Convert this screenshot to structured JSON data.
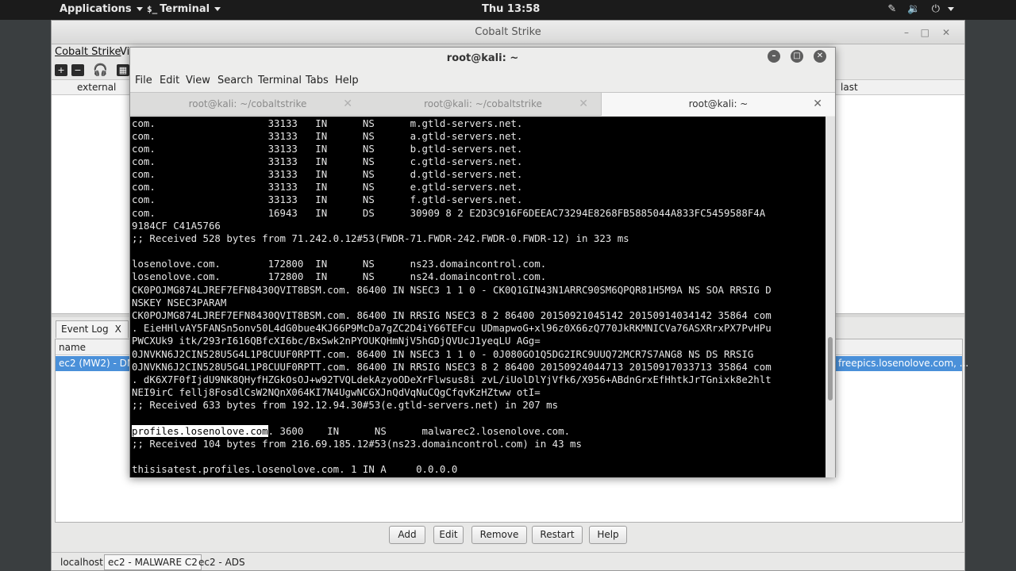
{
  "topbar": {
    "applications": "Applications",
    "terminal": "Terminal",
    "clock": "Thu 13:58"
  },
  "cobalt": {
    "title": "Cobalt Strike",
    "menu": [
      "Cobalt Strike",
      "View"
    ],
    "table_columns": {
      "external": "external",
      "last": "last"
    },
    "event_log_tab": "Event Log",
    "listener_columns": {
      "name": "name"
    },
    "listener_row": {
      "name": "ec2 (MW2) - DN",
      "hosts": "freepics.losenolove.com, ..."
    },
    "buttons": [
      "Add",
      "Edit",
      "Remove",
      "Restart",
      "Help"
    ],
    "bottom_tabs": [
      "localhost",
      "ec2 - MALWARE C2",
      "ec2 - ADS"
    ]
  },
  "terminal": {
    "title": "root@kali: ~",
    "menu": [
      "File",
      "Edit",
      "View",
      "Search",
      "Terminal",
      "Tabs",
      "Help"
    ],
    "tabs": [
      "root@kali: ~/cobaltstrike",
      "root@kali: ~/cobaltstrike",
      "root@kali: ~"
    ],
    "lines": [
      "com.                   33133   IN      NS      m.gtld-servers.net.",
      "com.                   33133   IN      NS      a.gtld-servers.net.",
      "com.                   33133   IN      NS      b.gtld-servers.net.",
      "com.                   33133   IN      NS      c.gtld-servers.net.",
      "com.                   33133   IN      NS      d.gtld-servers.net.",
      "com.                   33133   IN      NS      e.gtld-servers.net.",
      "com.                   33133   IN      NS      f.gtld-servers.net.",
      "com.                   16943   IN      DS      30909 8 2 E2D3C916F6DEEAC73294E8268FB5885044A833FC5459588F4A",
      "9184CF C41A5766",
      ";; Received 528 bytes from 71.242.0.12#53(FWDR-71.FWDR-242.FWDR-0.FWDR-12) in 323 ms",
      "",
      "losenolove.com.        172800  IN      NS      ns23.domaincontrol.com.",
      "losenolove.com.        172800  IN      NS      ns24.domaincontrol.com.",
      "CK0POJMG874LJREF7EFN8430QVIT8BSM.com. 86400 IN NSEC3 1 1 0 - CK0Q1GIN43N1ARRC90SM6QPQR81H5M9A NS SOA RRSIG D",
      "NSKEY NSEC3PARAM",
      "CK0POJMG874LJREF7EFN8430QVIT8BSM.com. 86400 IN RRSIG NSEC3 8 2 86400 20150921045142 20150914034142 35864 com",
      ". EieHHlvAY5FANSn5onv50L4dG0bue4KJ66P9McDa7gZC2D4iY66TEFcu UDmapwoG+xl96z0X66zQ770JkRKMNICVa76ASXRrxPX7PvHPu",
      "PWCXUk9 itk/293rI616QBfcXI6bc/BxSwk2nPYOUKQHmNjV5hGDjQVUcJ1yeqLU AGg=",
      "0JNVKN6J2CIN528U5G4L1P8CUUF0RPTT.com. 86400 IN NSEC3 1 1 0 - 0J080GO1Q5DG2IRC9UUQ72MCR7S7ANG8 NS DS RRSIG",
      "0JNVKN6J2CIN528U5G4L1P8CUUF0RPTT.com. 86400 IN RRSIG NSEC3 8 2 86400 20150924044713 20150917033713 35864 com",
      ". dK6X7F0fIjdU9NK8QHyfHZGkOsOJ+w92TVQLdekAzyoODeXrFlwsus8i zvL/iUolDlYjVfk6/X956+ABdnGrxEfHhtkJrTGnixk8e2hlt",
      "NEI9irC fellj8FosdlCsW2NQnX064KI7N4UgwNCGXJnQdVqNuCQgCfqvKzHZtww otI=",
      ";; Received 633 bytes from 192.12.94.30#53(e.gtld-servers.net) in 207 ms",
      "",
      ". 3600    IN      NS      malwarec2.losenolove.com.",
      ";; Received 104 bytes from 216.69.185.12#53(ns23.domaincontrol.com) in 43 ms",
      "",
      "thisisatest.profiles.losenolove.com. 1 IN A     0.0.0.0"
    ],
    "highlighted_prefix": "profiles.losenolove.com"
  }
}
